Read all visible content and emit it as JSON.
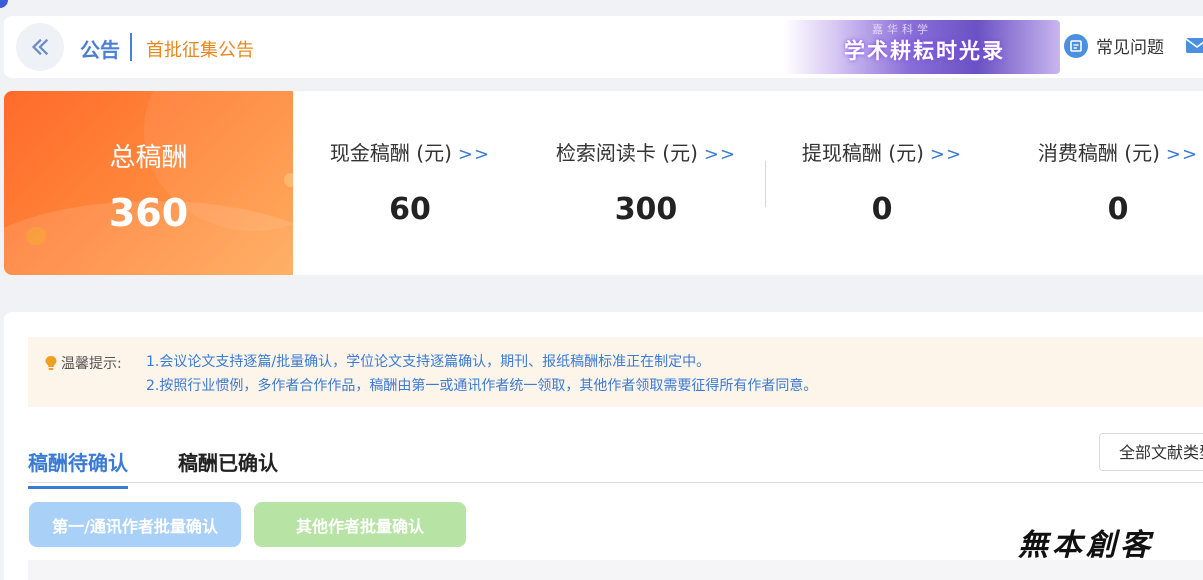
{
  "header": {
    "breadcrumb_main": "公告",
    "breadcrumb_sub": "首批征集公告",
    "banner_sup": "嘉华科学",
    "banner_text": "学术耕耘时光录",
    "faq_label": "常见问题"
  },
  "summary": {
    "total_label": "总稿酬",
    "total_value": "360",
    "arrow": ">>",
    "stats": [
      {
        "label": "现金稿酬 (元)",
        "value": "60"
      },
      {
        "label": "检索阅读卡 (元)",
        "value": "300"
      },
      {
        "label": "提现稿酬 (元)",
        "value": "0"
      },
      {
        "label": "消费稿酬 (元)",
        "value": "0"
      }
    ]
  },
  "notice": {
    "title": "温馨提示:",
    "lines": [
      "1.会议论文支持逐篇/批量确认，学位论文支持逐篇确认，期刊、报纸稿酬标准正在制定中。",
      "2.按照行业惯例，多作者合作作品，稿酬由第一或通讯作者统一领取，其他作者领取需要征得所有作者同意。"
    ]
  },
  "tabs": [
    {
      "label": "稿酬待确认",
      "active": true
    },
    {
      "label": "稿酬已确认",
      "active": false
    }
  ],
  "filter": {
    "value": "全部文献类型"
  },
  "buttons": {
    "batch_first_author": "第一/通讯作者批量确认",
    "batch_other_author": "其他作者批量确认"
  },
  "watermark": "無本創客",
  "colors": {
    "accent_blue": "#3a7bd5",
    "orange": "#ff7a33",
    "notice_bg": "#fdf4ea"
  }
}
